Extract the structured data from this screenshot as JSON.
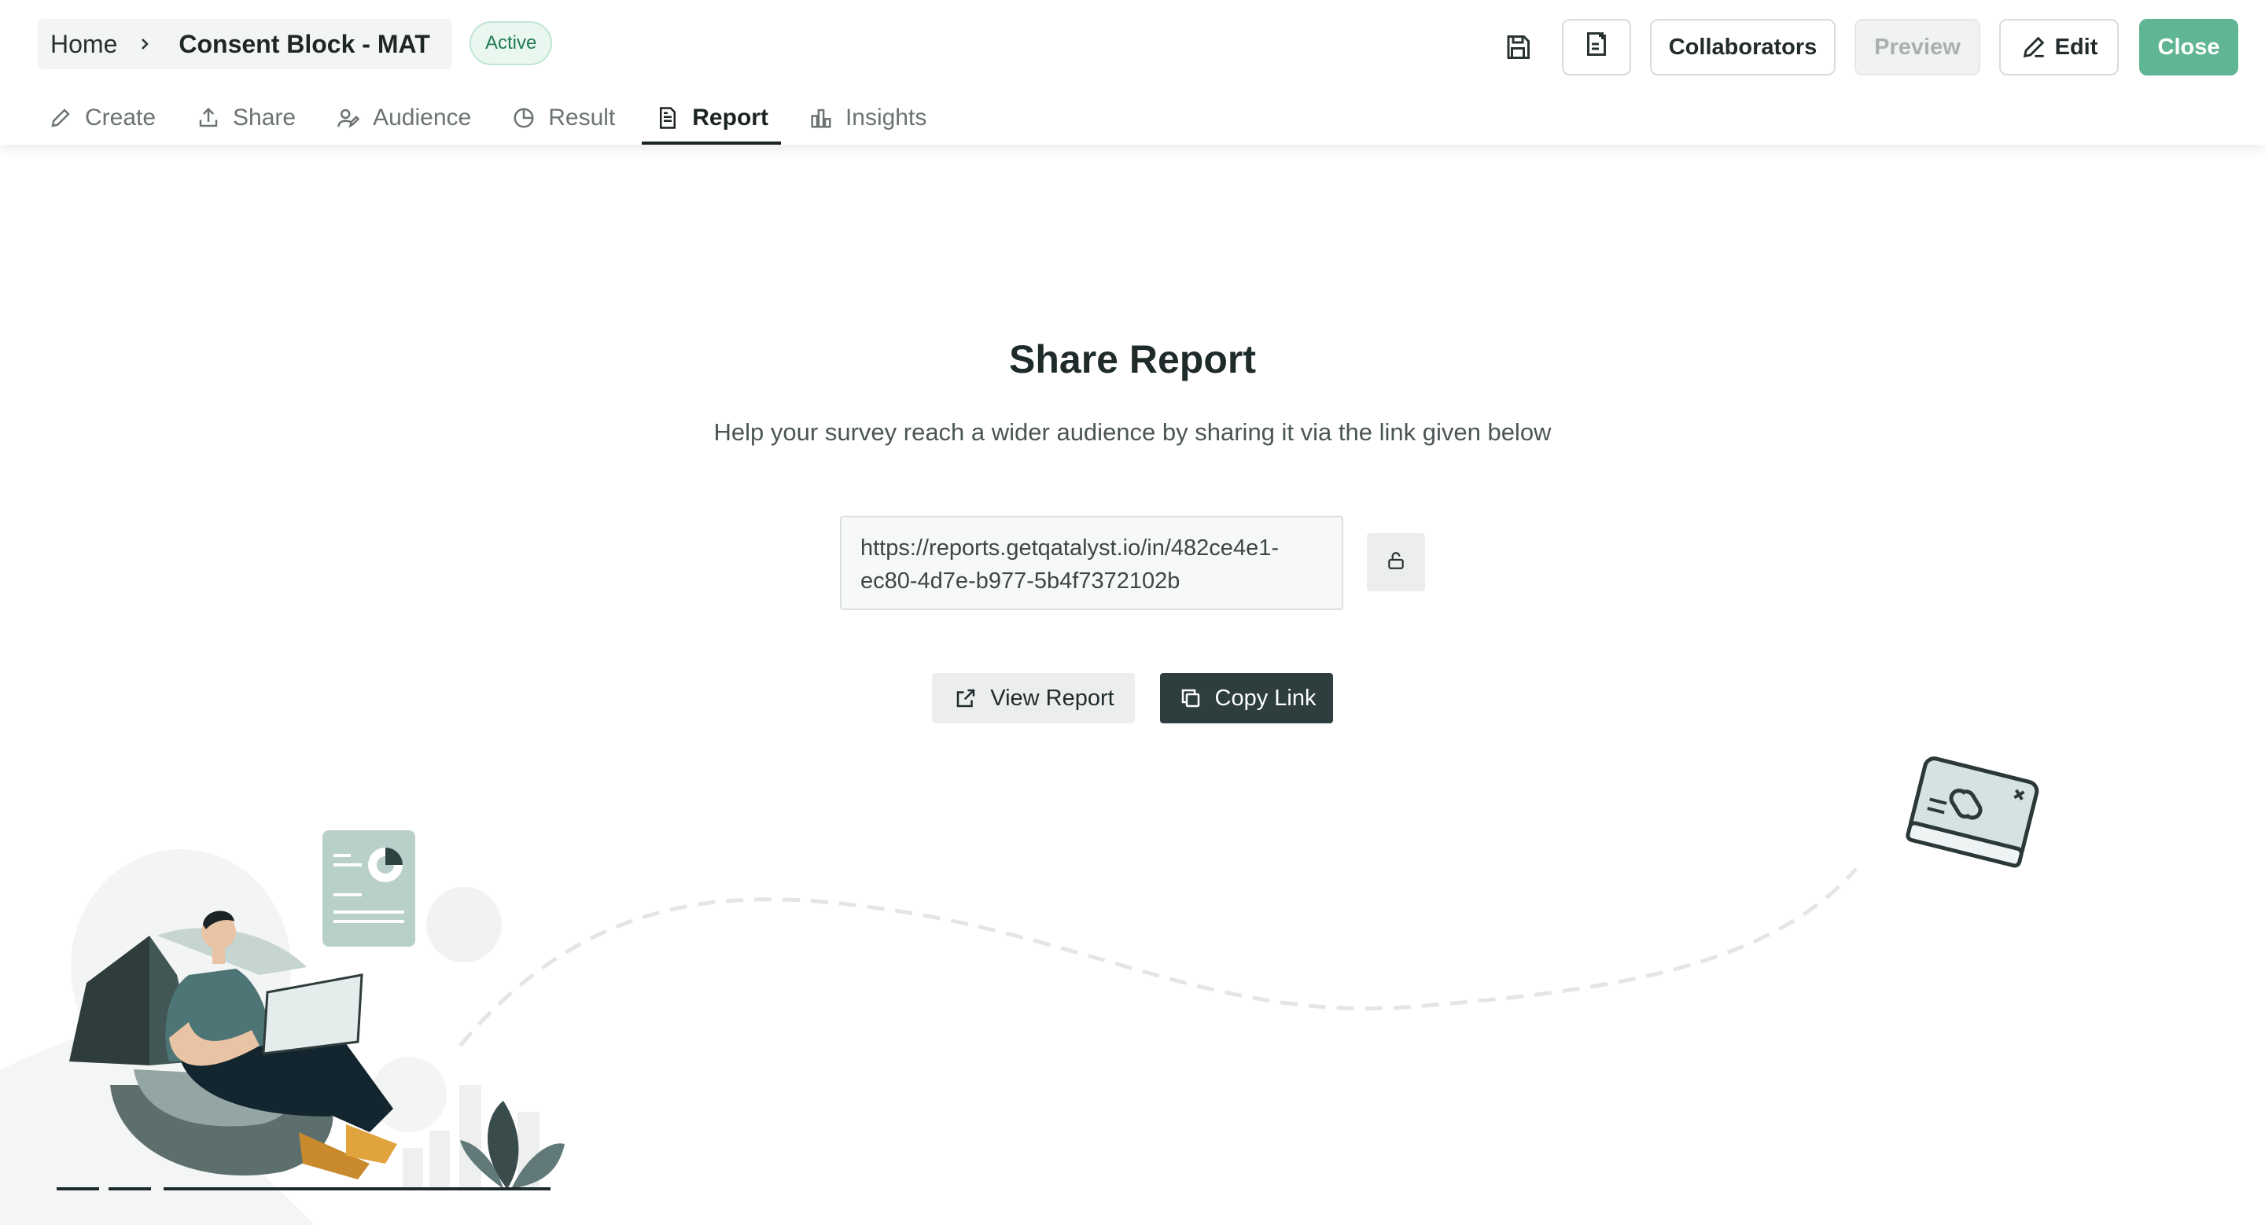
{
  "header": {
    "breadcrumb_home": "Home",
    "survey_title": "Consent Block - MAT",
    "status_badge": "Active",
    "collaborators_label": "Collaborators",
    "preview_label": "Preview",
    "edit_label": "Edit",
    "close_label": "Close"
  },
  "tabs": [
    {
      "label": "Create",
      "icon": "pencil-icon"
    },
    {
      "label": "Share",
      "icon": "upload-share-icon"
    },
    {
      "label": "Audience",
      "icon": "users-icon"
    },
    {
      "label": "Result",
      "icon": "pie-chart-icon"
    },
    {
      "label": "Report",
      "icon": "document-icon",
      "active": true
    },
    {
      "label": "Insights",
      "icon": "bar-chart-icon"
    }
  ],
  "main": {
    "title": "Share Report",
    "subtitle": "Help your survey reach a wider audience by sharing it via the link given below",
    "link_line1": "https://reports.getqatalyst.io/in/482ce4e1-",
    "link_line2": "ec80-4d7e-b977-5b4f7372102b",
    "view_report_label": "View Report",
    "copy_link_label": "Copy Link"
  },
  "colors": {
    "accent": "#5fb594",
    "dark_button": "#2e3d3e",
    "badge_text": "#1f7a55",
    "badge_bg": "#eaf7f0"
  }
}
